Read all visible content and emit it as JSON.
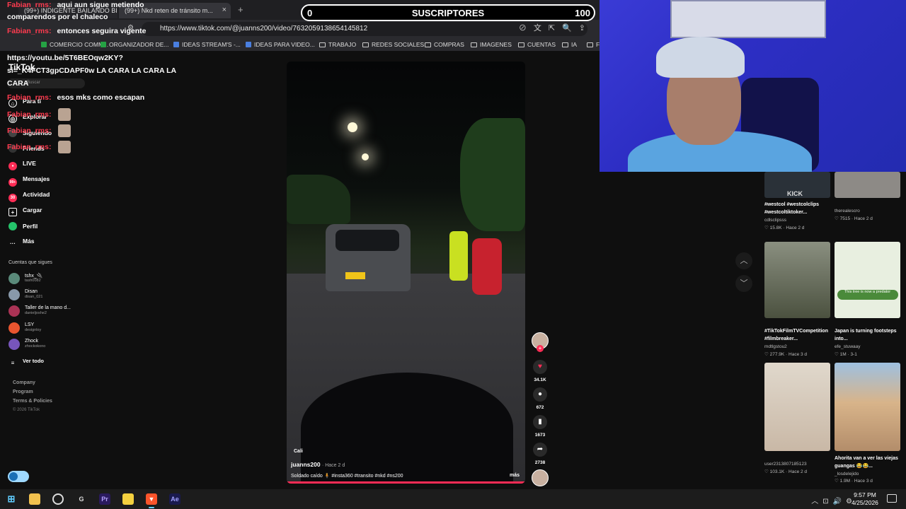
{
  "browser": {
    "tabs": [
      {
        "label": "(99+) INDIGENTE BAILANDO BILDE..."
      },
      {
        "label": "(99+) Nkd reten de tránsito m..."
      }
    ],
    "url": "https://www.tiktok.com/@juanns200/video/7632059138654145812",
    "bookmarks": [
      {
        "label": "COMERCIO COMM...",
        "icon": "green-sheet"
      },
      {
        "label": "ORGANIZADOR DE...",
        "icon": "green-sheet"
      },
      {
        "label": "IDEAS STREAM'S -...",
        "icon": "blue-doc"
      },
      {
        "label": "IDEAS PARA VIDEO...",
        "icon": "blue-doc"
      },
      {
        "label": "TRABAJO",
        "icon": "folder"
      },
      {
        "label": "REDES SOCIALES",
        "icon": "folder"
      },
      {
        "label": "COMPRAS",
        "icon": "folder"
      },
      {
        "label": "IMAGENES",
        "icon": "folder"
      },
      {
        "label": "CUENTAS",
        "icon": "folder"
      },
      {
        "label": "IA",
        "icon": "folder"
      },
      {
        "label": "F",
        "icon": "folder"
      }
    ]
  },
  "subscriber_bar": {
    "left": "0",
    "title": "SUSCRIPTORES",
    "right": "100"
  },
  "chat": [
    {
      "user": "Fabian_rms:",
      "message": "aqui aun sigue metiendo"
    },
    {
      "user": "",
      "message": "comparendos por el chaleco"
    },
    {
      "user": "Fabian_rms:",
      "message": "entonces seguira vigente"
    },
    {
      "user": "Fabian_rms:",
      "message": "https://youtu.be/5T6BEOqw2KY?"
    },
    {
      "user": "",
      "message": "si=_K4FCT3gpCDAPF0w LA CARA LA CARA LA"
    },
    {
      "user": "",
      "message": "CARA"
    },
    {
      "user": "Fabian_rms:",
      "message": "esos mks como escapan"
    },
    {
      "user": "Fabian_rms:",
      "message": ""
    },
    {
      "user": "Fabian_rms:",
      "message": ""
    },
    {
      "user": "Fabian_rms:",
      "message": ""
    }
  ],
  "tiktok": {
    "logo": "TikTok",
    "search_placeholder": "Buscar",
    "nav": [
      {
        "label": "Para ti",
        "icon": "home-icon",
        "color": "#ffffff"
      },
      {
        "label": "Explorar",
        "icon": "compass-icon",
        "color": "#ffffff"
      },
      {
        "label": "Siguiendo",
        "icon": "following-icon",
        "color": "#ffffff"
      },
      {
        "label": "Friends",
        "icon": "friends-icon",
        "color": "#ffffff"
      },
      {
        "label": "LIVE",
        "icon": "live-icon",
        "color": "#fe2c55"
      },
      {
        "label": "Mensajes",
        "icon": "message-icon",
        "color": "#fe2c55",
        "badge": "99+"
      },
      {
        "label": "Actividad",
        "icon": "activity-icon",
        "color": "#fe2c55",
        "badge": "30"
      },
      {
        "label": "Cargar",
        "icon": "upload-icon",
        "color": "#ffffff"
      },
      {
        "label": "Perfil",
        "icon": "profile-icon",
        "color": "#25c36a"
      },
      {
        "label": "Más",
        "icon": "more-icon",
        "color": "#ffffff"
      }
    ],
    "following_title": "Cuentas que sigues",
    "following": [
      {
        "name": "tshx_🔌",
        "handle": "tash0082",
        "color": "#5a8a7a"
      },
      {
        "name": "Disan",
        "handle": "disan_021",
        "color": "#8899aa"
      },
      {
        "name": "Taller de la mano d...",
        "handle": "danieljoshe2",
        "color": "#aa3355"
      },
      {
        "name": "LSY",
        "handle": "designloy",
        "color": "#e8552f"
      },
      {
        "name": "Zhock",
        "handle": "zhockokono",
        "color": "#7755bb"
      }
    ],
    "see_all": "Ver todo",
    "footer": [
      "Company",
      "Program",
      "Terms & Policies"
    ],
    "copyright": "© 2026 TikTok"
  },
  "video": {
    "location": "Cali",
    "author": "juanns200",
    "time": "· Hace 2 d",
    "caption": "Soldado caído 🧍 #insta360 #transito #nkd #ns200",
    "more": "más",
    "likes": "34.1K",
    "comments": "672",
    "saves": "1673",
    "shares": "2738"
  },
  "related": [
    {
      "title": "#westcol #westcolclips #westcoltiktoker...",
      "user": "cdlsclipsss",
      "meta": "♡ 15.8K · Hace 2 d",
      "color": "#2a3138"
    },
    {
      "title": "",
      "user": "therealescro",
      "meta": "♡ 7515 · Hace 2 d",
      "color": "#8d8a86"
    },
    {
      "title": "#TikTokFilmTVCompetition #filmbreaker...",
      "user": "mdtlgstou2",
      "meta": "♡ 277.9K · Hace 3 d",
      "color": "#6f7563"
    },
    {
      "title": "Japan is turning footsteps into...",
      "user": "efe_stuwaay",
      "meta": "♡ 1M · 3-1",
      "color": "#e8efe0"
    },
    {
      "title": "",
      "user": "user2313807185123",
      "meta": "♡ 103.1K · Hace 2 d",
      "color": "#c9b8a6"
    },
    {
      "title": "Ahorita van a ver las viejas guangas 😂😂...",
      "user": "_losdelejido",
      "meta": "♡ 1.9M · Hace 3 d",
      "color": "#b38d6a"
    }
  ],
  "overlay_text": "KICK",
  "related_thumb_caption": "This tree is now a predator",
  "taskbar": {
    "apps": [
      "start-icon",
      "search-icon",
      "explorer-icon",
      "obs-icon",
      "app-icon",
      "premiere-icon",
      "notes-icon",
      "brave-icon",
      "aftereffects-icon"
    ],
    "time": "9:57 PM",
    "date": "4/25/2026"
  },
  "colors": {
    "accent": "#fe2c55",
    "chat_user": "#ff3b4f",
    "webcam_bg": "#2d2ec4"
  }
}
